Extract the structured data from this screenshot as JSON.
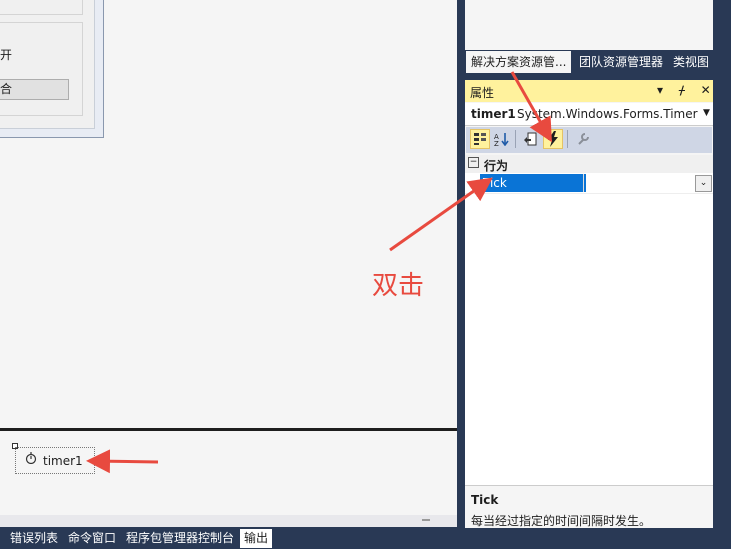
{
  "designer": {
    "frag_open": "开",
    "frag_button": "合",
    "tray_component": "timer1"
  },
  "bottom_tabs": [
    "错误列表",
    "命令窗口",
    "程序包管理器控制台",
    "输出"
  ],
  "solution_tabs": [
    "解决方案资源管...",
    "团队资源管理器",
    "类视图"
  ],
  "properties": {
    "title": "属性",
    "title_buttons": "▾ ᚋ ✕",
    "object_name": "timer1",
    "object_type": "System.Windows.Forms.Timer",
    "category": "行为",
    "event_name": "Tick",
    "event_value": "",
    "description_title": "Tick",
    "description_text": "每当经过指定的时间间隔时发生。"
  },
  "annotation": {
    "label": "双击",
    "color": "#e84a3f"
  },
  "colors": {
    "chrome": "#293955",
    "highlight": "#fff29d",
    "selection": "#0a74d6"
  }
}
